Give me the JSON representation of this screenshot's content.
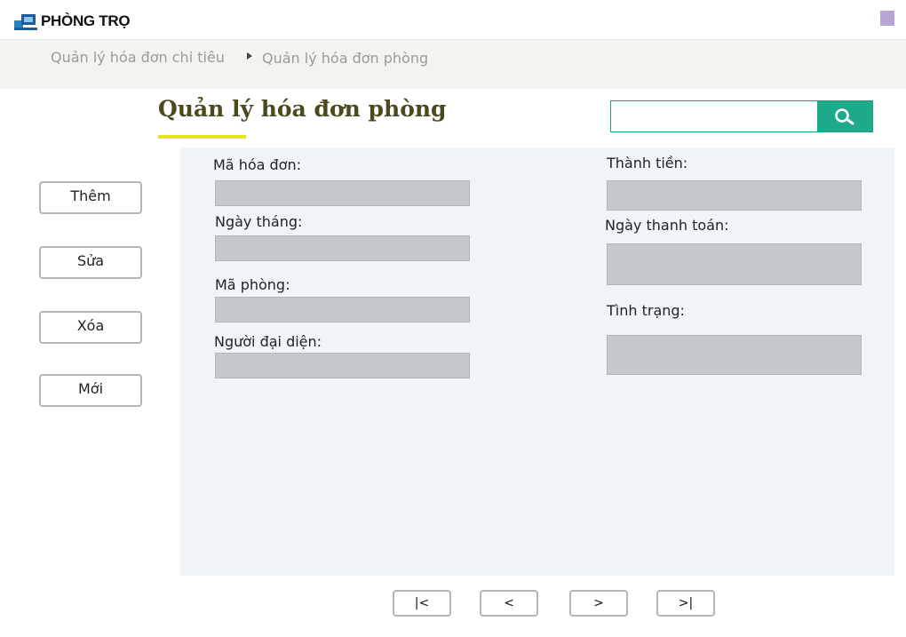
{
  "app": {
    "logo_text": "PHÒNG TRỌ"
  },
  "breadcrumb": [
    {
      "label": "Quản lý hóa đơn chi tiêu"
    },
    {
      "label": "Quản lý hóa đơn phòng"
    }
  ],
  "page": {
    "title": "Quản lý hóa đơn phòng"
  },
  "search": {
    "value": "",
    "placeholder": "",
    "icon": "search-icon"
  },
  "actions": {
    "add": "Thêm",
    "edit": "Sửa",
    "delete": "Xóa",
    "new": "Mới"
  },
  "form": {
    "left": [
      {
        "label": "Mã hóa đơn:",
        "value": ""
      },
      {
        "label": "Ngày tháng:",
        "value": ""
      },
      {
        "label": "Mã phòng:",
        "value": ""
      },
      {
        "label": "Người đại diện:",
        "value": ""
      }
    ],
    "right": [
      {
        "label": "Thành tiền:",
        "value": ""
      },
      {
        "label": "Ngày thanh toán:",
        "value": ""
      },
      {
        "label": "Tình trạng:",
        "value": ""
      }
    ]
  },
  "pager": {
    "first": "|<",
    "prev": "<",
    "next": ">",
    "last": ">|"
  },
  "colors": {
    "accent": "#1fa98b",
    "title": "#4b4a1e",
    "underline": "#e8e517",
    "field": "#c4c8cc",
    "panel": "#f1f4f7"
  }
}
